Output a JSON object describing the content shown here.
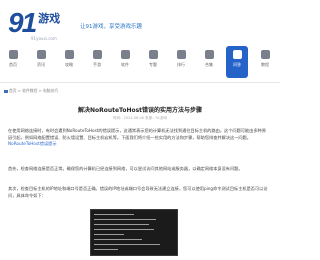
{
  "header": {
    "logo_number": "91",
    "logo_text": "游戏",
    "logo_sub": "91youxi.com",
    "slogan": "让91游戏，享受游戏乐趣"
  },
  "nav": {
    "items": [
      {
        "label": "首页",
        "icon": "home-icon"
      },
      {
        "label": "资讯",
        "icon": "news-icon"
      },
      {
        "label": "攻略",
        "icon": "guide-icon"
      },
      {
        "label": "手游",
        "icon": "mobile-game-icon"
      },
      {
        "label": "软件",
        "icon": "software-icon"
      },
      {
        "label": "专题",
        "icon": "topic-icon"
      },
      {
        "label": "排行",
        "icon": "rank-icon"
      },
      {
        "label": "合集",
        "icon": "collection-icon"
      },
      {
        "label": "问答",
        "icon": "qa-icon"
      },
      {
        "label": "教程",
        "icon": "tutorial-icon"
      }
    ],
    "active_index": 8
  },
  "breadcrumb": "首页 > 软件教程 > 电脑技巧",
  "article": {
    "title": "解决NoRouteToHost错误的实用方法与步骤",
    "meta": "时间：2024-06-08 来源：91游戏",
    "p1": "在使用网络连接时，有时会遇到NoRouteToHost的错误提示，这通常表示您的计算机无法找到通往目标主机的路由。这个问题可能由多种原因引起，例如网络配置错误、防火墙设置、目标主机宕机等。下面我们将介绍一些实用的方法和步骤，帮助您排查并解决这一问题。",
    "p1_link": "NoRouteToHost错误提示",
    "p2": "首先，检查网络连接是否正常。确保您的计算机已经连接到网络，可以尝试访问其他网站或服务器，以确定网络本身没有问题。",
    "p3": "其次，检查目标主机的IP地址和端口号是否正确。错误的IP地址或端口号会导致无法建立连接，您可以使用ping命令测试目标主机是否可以访问，具体命令如下："
  },
  "colors": {
    "brand": "#1f4e9d",
    "active_nav": "#2563c9",
    "link": "#2d6ad0"
  }
}
